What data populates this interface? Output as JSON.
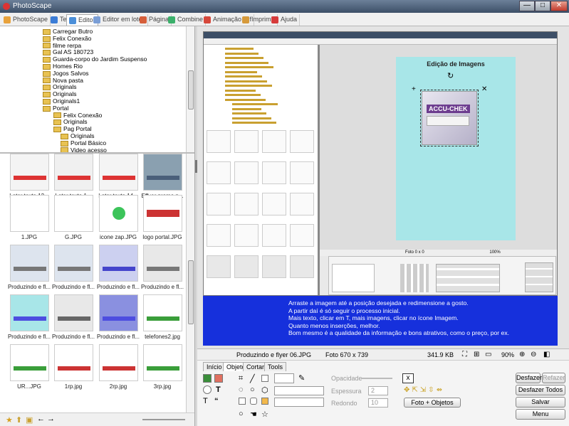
{
  "app": {
    "title": "PhotoScape"
  },
  "window_buttons": {
    "minimize": "—",
    "maximize": "□",
    "close": "✕"
  },
  "menu_tabs": [
    {
      "label": "PhotoScape",
      "color": "#e8a23c"
    },
    {
      "label": "Tela",
      "color": "#3b7cd6"
    },
    {
      "label": "Editor",
      "color": "#4b8fd9"
    },
    {
      "label": "Editor em lotes",
      "color": "#7a9ed6"
    },
    {
      "label": "Página",
      "color": "#d65f3b"
    },
    {
      "label": "Combine",
      "color": "#3bb06b"
    },
    {
      "label": "Animação Gif",
      "color": "#d6483b"
    },
    {
      "label": "Imprimir",
      "color": "#d69a3b"
    },
    {
      "label": "Ajuda",
      "color": "#d63b3b"
    }
  ],
  "tree": {
    "items": [
      "Carregar Butro",
      "Felix Conexão",
      "filme rerpa",
      "Gal AS 180723",
      "Guarda-corpo do Jardim Suspenso",
      "Homes Rio",
      "Jogos Salvos",
      "Nova pasta",
      "Originals",
      "Originals",
      "Originals1",
      "Portal",
      "Felix Conexão",
      "Originals",
      "Pag Portal",
      "Originals",
      "Portal Básico",
      "Video acesso"
    ]
  },
  "thumbnails": [
    {
      "label": "Lotar texto 12..."
    },
    {
      "label": "Lotar texto 1..."
    },
    {
      "label": "Lotar texto 14..."
    },
    {
      "label": "Effver promo p..."
    },
    {
      "label": "1.JPG"
    },
    {
      "label": "G.JPG"
    },
    {
      "label": "icone zap.JPG"
    },
    {
      "label": "logo portal.JPG"
    },
    {
      "label": "Produzindo e fl..."
    },
    {
      "label": "Produzindo e fl..."
    },
    {
      "label": "Produzindo e fl..."
    },
    {
      "label": "Produzindo e fl..."
    },
    {
      "label": "Produzindo e fl..."
    },
    {
      "label": "Produzindo e fl..."
    },
    {
      "label": "Produzindo e fl..."
    },
    {
      "label": "telefones2.jpg"
    },
    {
      "label": "UR...JPG"
    },
    {
      "label": "1rp.jpg"
    },
    {
      "label": "2rp.jpg"
    },
    {
      "label": "3rp.jpg"
    }
  ],
  "inner_screenshot": {
    "canvas_title": "Edição de Imagens",
    "product_label": "ACCU-CHEK",
    "status": "Foto 0 x 0",
    "zoom": "100%"
  },
  "instructions": [
    "Arraste a imagem até a posição desejada e redimensione a gosto.",
    "A partir daí é só seguir o processo inicial.",
    "Mais texto, clicar em T, mais imagens, clicar no ícone Imagem.",
    "Quanto menos inserções, melhor.",
    "Bom mesmo é a qualidade da informação e bons atrativos, como o preço, por ex."
  ],
  "status_bar": {
    "filename": "Produzindo e flyer 06.JPG",
    "dimensions": "Foto 670 x 739",
    "filesize": "341.9 KB",
    "zoom": "90%"
  },
  "bottom_tabs": [
    "Início",
    "Objeto",
    "Cortar",
    "Tools"
  ],
  "object_panel": {
    "opacity_label": "Opacidade",
    "thickness_label": "Espessura",
    "rounded_label": "Redondo",
    "thickness_value": "2",
    "rounded_value": "10",
    "photo_objects_label": "Foto + Objetos"
  },
  "right_buttons": {
    "undo": "Desfazer",
    "redo": "Refazer",
    "undo_all": "Desfazer Todos",
    "save": "Salvar",
    "menu": "Menu"
  }
}
